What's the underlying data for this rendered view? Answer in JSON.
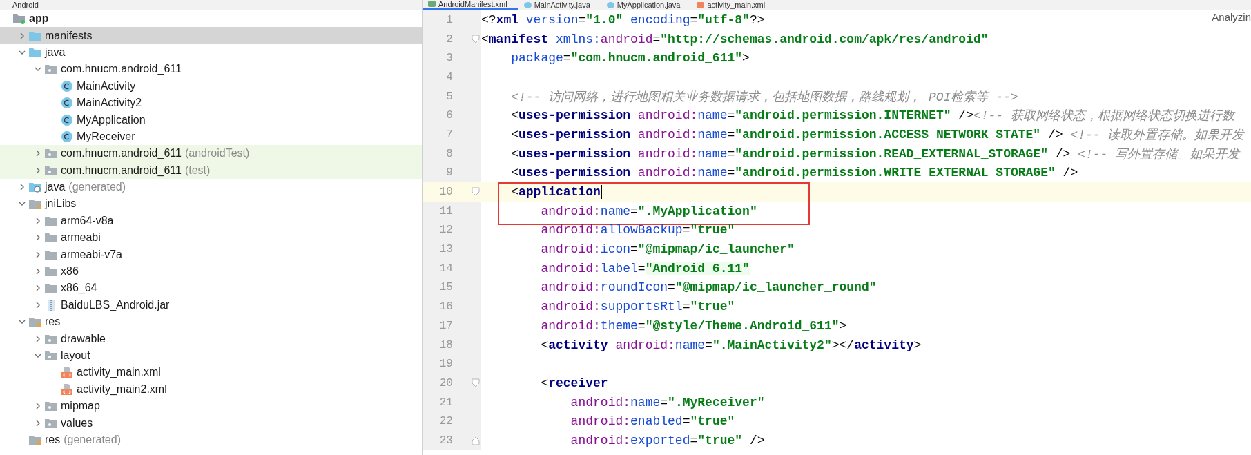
{
  "project_panel": {
    "view_label": "Android",
    "tree": [
      {
        "label": "app",
        "kind": "module",
        "selected": false,
        "children": [
          {
            "label": "manifests",
            "kind": "folder_blue",
            "expanded": false,
            "selected": true
          },
          {
            "label": "java",
            "kind": "folder_blue",
            "expanded": true,
            "selected": false,
            "children": [
              {
                "label": "com.hnucm.android_611",
                "kind": "package",
                "expanded": true,
                "selected": false,
                "children": [
                  {
                    "label": "MainActivity",
                    "kind": "class",
                    "selected": false
                  },
                  {
                    "label": "MainActivity2",
                    "kind": "class",
                    "selected": false
                  },
                  {
                    "label": "MyApplication",
                    "kind": "class",
                    "selected": false
                  },
                  {
                    "label": "MyReceiver",
                    "kind": "class",
                    "selected": false
                  }
                ]
              },
              {
                "label": "com.hnucm.android_611",
                "suffix": "(androidTest)",
                "tinted": true,
                "kind": "package",
                "expanded": false,
                "selected": false
              },
              {
                "label": "com.hnucm.android_611",
                "suffix": "(test)",
                "tinted": true,
                "kind": "package",
                "expanded": false,
                "selected": false
              }
            ]
          },
          {
            "label": "java",
            "suffix": "(generated)",
            "kind": "folder_generated",
            "expanded": false,
            "selected": false
          },
          {
            "label": "jniLibs",
            "kind": "folder_res",
            "expanded": true,
            "selected": false,
            "children": [
              {
                "label": "arm64-v8a",
                "kind": "folder_grey",
                "expanded": false,
                "selected": false
              },
              {
                "label": "armeabi",
                "kind": "folder_grey",
                "expanded": false,
                "selected": false
              },
              {
                "label": "armeabi-v7a",
                "kind": "folder_grey",
                "expanded": false,
                "selected": false
              },
              {
                "label": "x86",
                "kind": "folder_grey",
                "expanded": false,
                "selected": false
              },
              {
                "label": "x86_64",
                "kind": "folder_grey",
                "expanded": false,
                "selected": false
              },
              {
                "label": "BaiduLBS_Android.jar",
                "kind": "jar",
                "expanded": false,
                "selected": false
              }
            ]
          },
          {
            "label": "res",
            "kind": "folder_res",
            "expanded": true,
            "selected": false,
            "children": [
              {
                "label": "drawable",
                "kind": "package",
                "expanded": false,
                "selected": false
              },
              {
                "label": "layout",
                "kind": "package",
                "expanded": true,
                "selected": false,
                "children": [
                  {
                    "label": "activity_main.xml",
                    "kind": "xml",
                    "selected": false
                  },
                  {
                    "label": "activity_main2.xml",
                    "kind": "xml",
                    "selected": false
                  }
                ]
              },
              {
                "label": "mipmap",
                "kind": "package",
                "expanded": false,
                "selected": false
              },
              {
                "label": "values",
                "kind": "package",
                "expanded": false,
                "selected": false
              }
            ]
          },
          {
            "label": "res",
            "suffix": "(generated)",
            "kind": "folder_res",
            "selected": false
          }
        ]
      }
    ]
  },
  "editor": {
    "tabs": [
      {
        "label": "AndroidManifest.xml",
        "kind": "manifest",
        "selected": true
      },
      {
        "label": "MainActivity.java",
        "kind": "class",
        "selected": false
      },
      {
        "label": "MyApplication.java",
        "kind": "class",
        "selected": false
      },
      {
        "label": "activity_main.xml",
        "kind": "xml",
        "selected": false
      }
    ],
    "status": "Analyzin",
    "lines": [
      {
        "n": "1",
        "current": false,
        "segs": [
          {
            "kind": "p",
            "text": "<?"
          },
          {
            "kind": "tag",
            "text": "xml"
          },
          {
            "kind": "attr",
            "text": " version"
          },
          {
            "kind": "p",
            "text": "="
          },
          {
            "kind": "val",
            "text": "\"1.0\""
          },
          {
            "kind": "attr",
            "text": " encoding"
          },
          {
            "kind": "p",
            "text": "="
          },
          {
            "kind": "val",
            "text": "\"utf-8\""
          },
          {
            "kind": "p",
            "text": "?>"
          }
        ]
      },
      {
        "n": "2",
        "kind": "fold_start",
        "current": false,
        "segs": [
          {
            "kind": "p",
            "text": "<"
          },
          {
            "kind": "tag",
            "text": "manifest"
          },
          {
            "kind": "attr",
            "text": " xmlns:"
          },
          {
            "kind": "ns",
            "text": "android"
          },
          {
            "kind": "p",
            "text": "="
          },
          {
            "kind": "val",
            "text": "\"http://schemas.android.com/apk/res/android\""
          }
        ]
      },
      {
        "n": "3",
        "current": false,
        "segs": [
          {
            "kind": "attr",
            "text": "    package"
          },
          {
            "kind": "p",
            "text": "="
          },
          {
            "kind": "val",
            "text": "\"com.hnucm.android_611\""
          },
          {
            "kind": "p",
            "text": ">"
          }
        ]
      },
      {
        "n": "4",
        "current": false
      },
      {
        "n": "5",
        "current": false,
        "segs": [
          {
            "kind": "com",
            "text": "    <!-- 访问网络，进行地图相关业务数据请求，包括地图数据，路线规划， POI检索等 -->"
          }
        ]
      },
      {
        "n": "6",
        "current": false,
        "segs": [
          {
            "kind": "p",
            "text": "    <"
          },
          {
            "kind": "tag",
            "text": "uses-permission"
          },
          {
            "kind": "ns",
            "text": " android:"
          },
          {
            "kind": "attr",
            "text": "name"
          },
          {
            "kind": "p",
            "text": "="
          },
          {
            "kind": "val",
            "text": "\"android.permission.INTERNET\""
          },
          {
            "kind": "p",
            "text": " />"
          },
          {
            "kind": "com",
            "text": "<!-- 获取网络状态，根据网络状态切换进行数"
          }
        ]
      },
      {
        "n": "7",
        "current": false,
        "segs": [
          {
            "kind": "p",
            "text": "    <"
          },
          {
            "kind": "tag",
            "text": "uses-permission"
          },
          {
            "kind": "ns",
            "text": " android:"
          },
          {
            "kind": "attr",
            "text": "name"
          },
          {
            "kind": "p",
            "text": "="
          },
          {
            "kind": "val",
            "text": "\"android.permission.ACCESS_NETWORK_STATE\""
          },
          {
            "kind": "p",
            "text": " />"
          },
          {
            "kind": "com",
            "text": " <!-- 读取外置存储。如果开发"
          }
        ]
      },
      {
        "n": "8",
        "current": false,
        "segs": [
          {
            "kind": "p",
            "text": "    <"
          },
          {
            "kind": "tag",
            "text": "uses-permission"
          },
          {
            "kind": "ns",
            "text": " android:"
          },
          {
            "kind": "attr",
            "text": "name"
          },
          {
            "kind": "p",
            "text": "="
          },
          {
            "kind": "val",
            "text": "\"android.permission.READ_EXTERNAL_STORAGE\""
          },
          {
            "kind": "p",
            "text": " />"
          },
          {
            "kind": "com",
            "text": " <!-- 写外置存储。如果开发"
          }
        ]
      },
      {
        "n": "9",
        "current": false,
        "segs": [
          {
            "kind": "p",
            "text": "    <"
          },
          {
            "kind": "tag",
            "text": "uses-permission"
          },
          {
            "kind": "ns",
            "text": " android:"
          },
          {
            "kind": "attr",
            "text": "name"
          },
          {
            "kind": "p",
            "text": "="
          },
          {
            "kind": "val",
            "text": "\"android.permission.WRITE_EXTERNAL_STORAGE\""
          },
          {
            "kind": "p",
            "text": " />"
          }
        ]
      },
      {
        "n": "10",
        "kind": "fold_start",
        "current": true,
        "caret": true,
        "boxed": true,
        "segs": [
          {
            "kind": "p",
            "text": "    <"
          },
          {
            "kind": "tag",
            "text": "application"
          }
        ]
      },
      {
        "n": "11",
        "current": false,
        "segs": [
          {
            "kind": "ns",
            "text": "        android:"
          },
          {
            "kind": "attr",
            "text": "name"
          },
          {
            "kind": "p",
            "text": "="
          },
          {
            "kind": "val",
            "text": "\".MyApplication\""
          }
        ]
      },
      {
        "n": "12",
        "current": false,
        "segs": [
          {
            "kind": "ns",
            "text": "        android:"
          },
          {
            "kind": "attr",
            "text": "allowBackup"
          },
          {
            "kind": "p",
            "text": "="
          },
          {
            "kind": "val",
            "text": "\"true\""
          }
        ]
      },
      {
        "n": "13",
        "current": false,
        "segs": [
          {
            "kind": "ns",
            "text": "        android:"
          },
          {
            "kind": "attr",
            "text": "icon"
          },
          {
            "kind": "p",
            "text": "="
          },
          {
            "kind": "val",
            "text": "\"@mipmap/ic_launcher\""
          }
        ]
      },
      {
        "n": "14",
        "current": false,
        "segs": [
          {
            "kind": "ns",
            "text": "        android:"
          },
          {
            "kind": "attr",
            "text": "label"
          },
          {
            "kind": "p",
            "text": "="
          },
          {
            "kind": "valbg",
            "text": "\"Android_6.11\""
          }
        ]
      },
      {
        "n": "15",
        "current": false,
        "segs": [
          {
            "kind": "ns",
            "text": "        android:"
          },
          {
            "kind": "attr",
            "text": "roundIcon"
          },
          {
            "kind": "p",
            "text": "="
          },
          {
            "kind": "val",
            "text": "\"@mipmap/ic_launcher_round\""
          }
        ]
      },
      {
        "n": "16",
        "current": false,
        "segs": [
          {
            "kind": "ns",
            "text": "        android:"
          },
          {
            "kind": "attr",
            "text": "supportsRtl"
          },
          {
            "kind": "p",
            "text": "="
          },
          {
            "kind": "val",
            "text": "\"true\""
          }
        ]
      },
      {
        "n": "17",
        "current": false,
        "segs": [
          {
            "kind": "ns",
            "text": "        android:"
          },
          {
            "kind": "attr",
            "text": "theme"
          },
          {
            "kind": "p",
            "text": "="
          },
          {
            "kind": "val",
            "text": "\"@style/Theme.Android_611\""
          },
          {
            "kind": "p",
            "text": ">"
          }
        ]
      },
      {
        "n": "18",
        "current": false,
        "segs": [
          {
            "kind": "p",
            "text": "        <"
          },
          {
            "kind": "tag",
            "text": "activity"
          },
          {
            "kind": "ns",
            "text": " android:"
          },
          {
            "kind": "attr",
            "text": "name"
          },
          {
            "kind": "p",
            "text": "="
          },
          {
            "kind": "val",
            "text": "\".MainActivity2\""
          },
          {
            "kind": "p",
            "text": "></"
          },
          {
            "kind": "tag",
            "text": "activity"
          },
          {
            "kind": "p",
            "text": ">"
          }
        ]
      },
      {
        "n": "19",
        "current": false
      },
      {
        "n": "20",
        "kind": "fold_start",
        "current": false,
        "segs": [
          {
            "kind": "p",
            "text": "        <"
          },
          {
            "kind": "tag",
            "text": "receiver"
          }
        ]
      },
      {
        "n": "21",
        "current": false,
        "segs": [
          {
            "kind": "ns",
            "text": "            android:"
          },
          {
            "kind": "attr",
            "text": "name"
          },
          {
            "kind": "p",
            "text": "="
          },
          {
            "kind": "val",
            "text": "\".MyReceiver\""
          }
        ]
      },
      {
        "n": "22",
        "current": false,
        "segs": [
          {
            "kind": "ns",
            "text": "            android:"
          },
          {
            "kind": "attr",
            "text": "enabled"
          },
          {
            "kind": "p",
            "text": "="
          },
          {
            "kind": "val",
            "text": "\"true\""
          }
        ]
      },
      {
        "n": "23",
        "kind": "fold_end",
        "current": false,
        "segs": [
          {
            "kind": "ns",
            "text": "            android:"
          },
          {
            "kind": "attr",
            "text": "exported"
          },
          {
            "kind": "p",
            "text": "="
          },
          {
            "kind": "val",
            "text": "\"true\""
          },
          {
            "kind": "p",
            "text": " />"
          }
        ]
      }
    ]
  }
}
